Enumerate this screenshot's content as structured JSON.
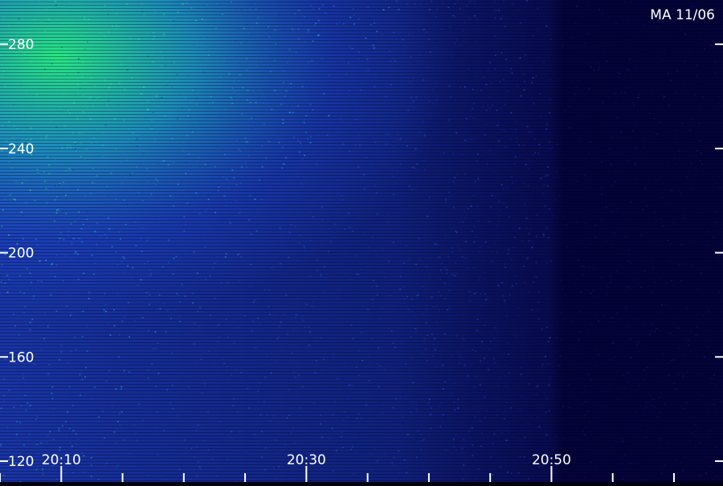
{
  "chart_data": {
    "type": "heatmap",
    "stamp": "MA 11/06",
    "x_ticks": [
      "20:10",
      "20:30",
      "20:50"
    ],
    "y_ticks": [
      280,
      240,
      200,
      160,
      120
    ],
    "ylim": [
      112,
      297
    ],
    "xlim": [
      "20:05",
      "21:04"
    ],
    "grid": false,
    "colors": {
      "background": "#000010",
      "low": "#03034a",
      "mid": "#1f4fd8",
      "high": "#25e08a",
      "label": "#ffffff"
    }
  }
}
